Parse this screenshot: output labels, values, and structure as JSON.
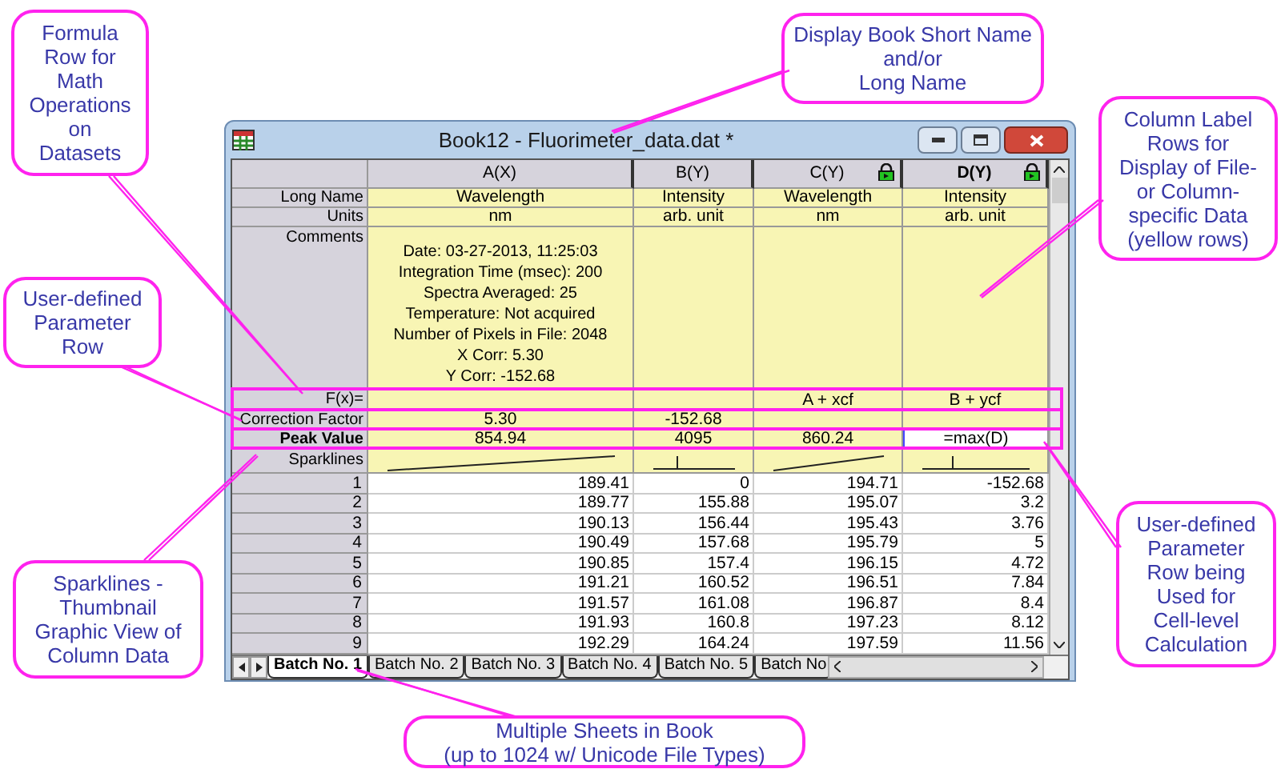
{
  "window": {
    "title": "Book12 - Fluorimeter_data.dat *"
  },
  "columns": [
    {
      "label": "A(X)",
      "locked": false,
      "active": false,
      "kind": "rising"
    },
    {
      "label": "B(Y)",
      "locked": false,
      "active": false,
      "kind": "peak"
    },
    {
      "label": "C(Y)",
      "locked": true,
      "active": false,
      "kind": "rising"
    },
    {
      "label": "D(Y)",
      "locked": true,
      "active": true,
      "kind": "peak"
    }
  ],
  "label_rows": [
    {
      "kind": "label",
      "label": "Long Name",
      "bold": false,
      "cells": [
        "Wavelength",
        "Intensity",
        "Wavelength",
        "Intensity"
      ]
    },
    {
      "kind": "label",
      "label": "Units",
      "bold": false,
      "cells": [
        "nm",
        "arb. unit",
        "nm",
        "arb. unit"
      ]
    },
    {
      "kind": "comments",
      "label": "Comments",
      "bold": false,
      "cells": [
        "Date: 03-27-2013, 11:25:03\nIntegration Time (msec): 200\nSpectra Averaged: 25\nTemperature: Not acquired\nNumber of Pixels in File: 2048\nX Corr: 5.30\nY Corr: -152.68",
        null,
        null,
        null
      ]
    },
    {
      "kind": "label",
      "label": "F(x)=",
      "bold": false,
      "cells": [
        null,
        null,
        "A + xcf",
        "B + ycf"
      ]
    },
    {
      "kind": "label",
      "label": "Correction Factor",
      "bold": false,
      "cells": [
        "5.30",
        "-152.68",
        null,
        null
      ]
    },
    {
      "kind": "label",
      "label": "Peak Value",
      "bold": true,
      "cells": [
        "854.94",
        "4095",
        "860.24",
        "=max(D)"
      ],
      "editing": [
        false,
        false,
        false,
        true
      ]
    },
    {
      "kind": "sparkline",
      "label": "Sparklines",
      "bold": false
    }
  ],
  "rows": [
    {
      "index": "1",
      "cells": [
        "189.41",
        "0",
        "194.71",
        "-152.68"
      ]
    },
    {
      "index": "2",
      "cells": [
        "189.77",
        "155.88",
        "195.07",
        "3.2"
      ]
    },
    {
      "index": "3",
      "cells": [
        "190.13",
        "156.44",
        "195.43",
        "3.76"
      ]
    },
    {
      "index": "4",
      "cells": [
        "190.49",
        "157.68",
        "195.79",
        "5"
      ]
    },
    {
      "index": "5",
      "cells": [
        "190.85",
        "157.4",
        "196.15",
        "4.72"
      ]
    },
    {
      "index": "6",
      "cells": [
        "191.21",
        "160.52",
        "196.51",
        "7.84"
      ]
    },
    {
      "index": "7",
      "cells": [
        "191.57",
        "161.08",
        "196.87",
        "8.4"
      ]
    },
    {
      "index": "8",
      "cells": [
        "191.93",
        "160.8",
        "197.23",
        "8.12"
      ]
    },
    {
      "index": "9",
      "cells": [
        "192.29",
        "164.24",
        "197.59",
        "11.56"
      ]
    }
  ],
  "sheet_tabs": [
    {
      "label": "Batch No. 1",
      "selected": true
    },
    {
      "label": "Batch No. 2",
      "selected": false
    },
    {
      "label": "Batch No. 3",
      "selected": false
    },
    {
      "label": "Batch No. 4",
      "selected": false
    },
    {
      "label": "Batch No. 5",
      "selected": false
    },
    {
      "label": "Batch No",
      "selected": false
    }
  ],
  "callouts": [
    {
      "text": "Formula\nRow for\nMath\nOperations\non\nDatasets"
    },
    {
      "text": "Display Book Short Name\nand/or\nLong Name"
    },
    {
      "text": "Column Label\nRows for\nDisplay of File-\nor Column-\nspecific Data\n(yellow rows)"
    },
    {
      "text": "User-defined\nParameter\nRow"
    },
    {
      "text": "Sparklines -\nThumbnail\nGraphic View of\nColumn Data"
    },
    {
      "text": "User-defined\nParameter\nRow being\nUsed for\nCell-level\nCalculation"
    },
    {
      "text": "Multiple Sheets in Book\n(up to 1024 w/ Unicode File Types)"
    }
  ]
}
